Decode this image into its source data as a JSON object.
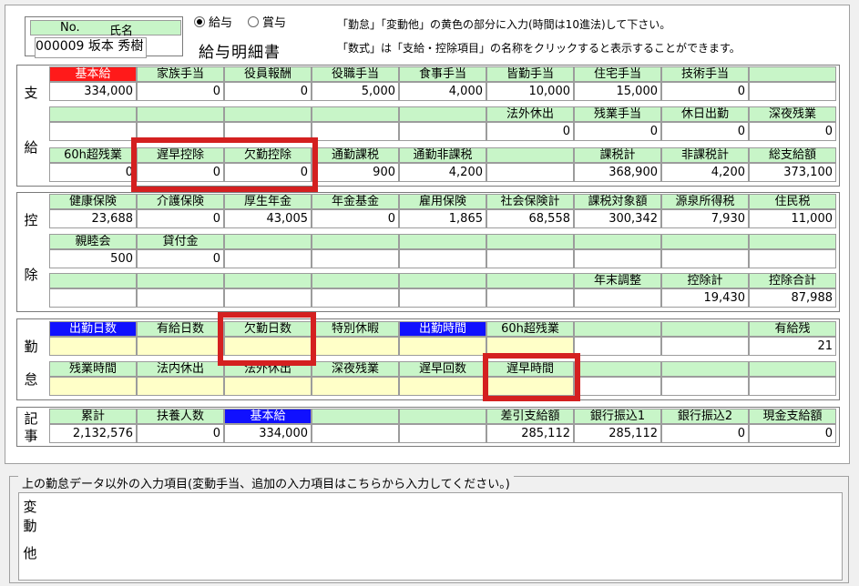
{
  "employee": {
    "no_label": "No.",
    "name_label": "氏名",
    "value": "000009 坂本 秀樹"
  },
  "pay_type": {
    "options": [
      {
        "label": "給与",
        "selected": true
      },
      {
        "label": "賞与",
        "selected": false
      }
    ]
  },
  "title": "給与明細書",
  "notes": [
    "「勤怠」「変動他」の黄色の部分に入力(時間は10進法)して下さい。",
    "「数式」は「支給・控除項目」の名称をクリックすると表示することができます。"
  ],
  "sections": {
    "shikyu": {
      "label1": "支",
      "label2": "給"
    },
    "koujo": {
      "label1": "控",
      "label2": "除"
    },
    "kintai": {
      "label1": "勤",
      "label2": "怠"
    },
    "kiji": {
      "label1": "記",
      "label2": "事"
    }
  },
  "shikyu_rows": [
    {
      "labels": [
        "基本給",
        "家族手当",
        "役員報酬",
        "役職手当",
        "食事手当",
        "皆勤手当",
        "住宅手当",
        "技術手当",
        ""
      ],
      "values": [
        "334,000",
        "0",
        "0",
        "5,000",
        "4,000",
        "10,000",
        "15,000",
        "0",
        ""
      ]
    },
    {
      "labels": [
        "",
        "",
        "",
        "",
        "",
        "法外休出",
        "残業手当",
        "休日出勤",
        "深夜残業"
      ],
      "values": [
        "",
        "",
        "",
        "",
        "",
        "0",
        "0",
        "0",
        "0"
      ]
    },
    {
      "labels": [
        "60h超残業",
        "遅早控除",
        "欠勤控除",
        "通勤課税",
        "通勤非課税",
        "",
        "課税計",
        "非課税計",
        "総支給額"
      ],
      "values": [
        "0",
        "0",
        "0",
        "900",
        "4,200",
        "",
        "368,900",
        "4,200",
        "373,100"
      ]
    }
  ],
  "koujo_rows": [
    {
      "labels": [
        "健康保険",
        "介護保険",
        "厚生年金",
        "年金基金",
        "雇用保険",
        "社会保険計",
        "課税対象額",
        "源泉所得税",
        "住民税"
      ],
      "values": [
        "23,688",
        "0",
        "43,005",
        "0",
        "1,865",
        "68,558",
        "300,342",
        "7,930",
        "11,000"
      ]
    },
    {
      "labels": [
        "親睦会",
        "貸付金",
        "",
        "",
        "",
        "",
        "",
        "",
        ""
      ],
      "values": [
        "500",
        "0",
        "",
        "",
        "",
        "",
        "",
        "",
        ""
      ]
    },
    {
      "labels": [
        "",
        "",
        "",
        "",
        "",
        "",
        "年末調整",
        "控除計",
        "控除合計"
      ],
      "values": [
        "",
        "",
        "",
        "",
        "",
        "",
        "",
        "19,430",
        "87,988"
      ]
    }
  ],
  "kintai_rows": [
    {
      "labels": [
        "出勤日数",
        "有給日数",
        "欠勤日数",
        "特別休暇",
        "出勤時間",
        "60h超残業",
        "",
        "",
        "有給残"
      ],
      "values": [
        "",
        "",
        "",
        "",
        "",
        "",
        "",
        "",
        "21"
      ]
    },
    {
      "labels": [
        "残業時間",
        "法内休出",
        "法外休出",
        "深夜残業",
        "遅早回数",
        "遅早時間",
        "",
        "",
        ""
      ],
      "values": [
        "",
        "",
        "",
        "",
        "",
        "",
        "",
        "",
        ""
      ]
    }
  ],
  "kiji_row": {
    "labels": [
      "累計",
      "扶養人数",
      "基本給",
      "",
      "",
      "差引支給額",
      "銀行振込1",
      "銀行振込2",
      "現金支給額"
    ],
    "values": [
      "2,132,576",
      "0",
      "334,000",
      "",
      "",
      "285,112",
      "285,112",
      "0",
      "0"
    ]
  },
  "hendou": {
    "group_title": "上の勤怠データ以外の入力項目(変動手当、追加の入力項目はこちらから入力してください。)",
    "label1": "変",
    "label2": "動",
    "label3": "他"
  },
  "colors": {
    "label_green": "#c8f5c8",
    "highlight_red": "#d42020",
    "input_yellow": "#ffffc8",
    "blue_label": "#1010ff",
    "red_label": "#ff1a1a"
  }
}
